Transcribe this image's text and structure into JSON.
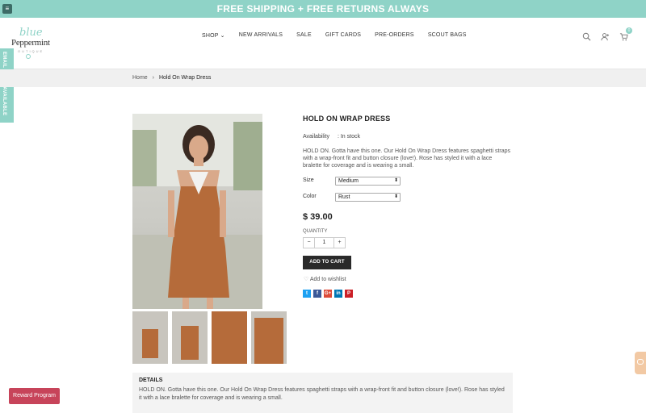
{
  "announcement": {
    "text": "FREE SHIPPING + FREE RETURNS ALWAYS"
  },
  "brand": {
    "line1": "blue",
    "line2": "Peppermint",
    "line3": "OUTIQUE"
  },
  "nav": {
    "shop": "SHOP",
    "new_arrivals": "NEW ARRIVALS",
    "sale": "SALE",
    "gift_cards": "GIFT CARDS",
    "pre_orders": "PRE-ORDERS",
    "scout_bags": "SCOUT BAGS"
  },
  "header_icons": [
    "search-icon",
    "user-plus-icon",
    "cart-icon"
  ],
  "cart": {
    "count": "0"
  },
  "side_tab": {
    "label": "EMAIL WHEN AVAILABLE"
  },
  "breadcrumb": {
    "home": "Home",
    "separator": "›",
    "current": "Hold On Wrap Dress"
  },
  "product": {
    "title": "HOLD ON WRAP DRESS",
    "availability_label": "Availability",
    "availability_value": ": In stock",
    "description": "HOLD ON. Gotta have this one. Our Hold On Wrap Dress features spaghetti straps with a wrap-front fit and button closure (love!). Rose has styled it with a lace bralette for coverage and is wearing a small.",
    "size_label": "Size",
    "size_value": "Medium",
    "color_label": "Color",
    "color_value": "Rust",
    "price": "$ 39.00",
    "quantity_label": "QUANTITY",
    "quantity_value": "1",
    "add_to_cart": "ADD TO CART",
    "wishlist": "Add to wishlist"
  },
  "share": [
    {
      "icon": "twitter-icon",
      "glyph": "t",
      "color": "#1da1f2"
    },
    {
      "icon": "facebook-icon",
      "glyph": "f",
      "color": "#3b5998"
    },
    {
      "icon": "google-plus-icon",
      "glyph": "G+",
      "color": "#dd4b39"
    },
    {
      "icon": "linkedin-icon",
      "glyph": "in",
      "color": "#0077b5"
    },
    {
      "icon": "pinterest-icon",
      "glyph": "P",
      "color": "#cb2027"
    }
  ],
  "details": {
    "heading": "DETAILS",
    "text": "HOLD ON. Gotta have this one. Our Hold On Wrap Dress features spaghetti straps with a wrap-front fit and button closure (love!). Rose has styled it with a lace bralette for coverage and is wearing a small."
  },
  "reward": {
    "label": "Reward Program"
  },
  "colors": {
    "accent": "#8fd3c7",
    "reward": "#c7445a",
    "dress": "#b56b3a"
  }
}
